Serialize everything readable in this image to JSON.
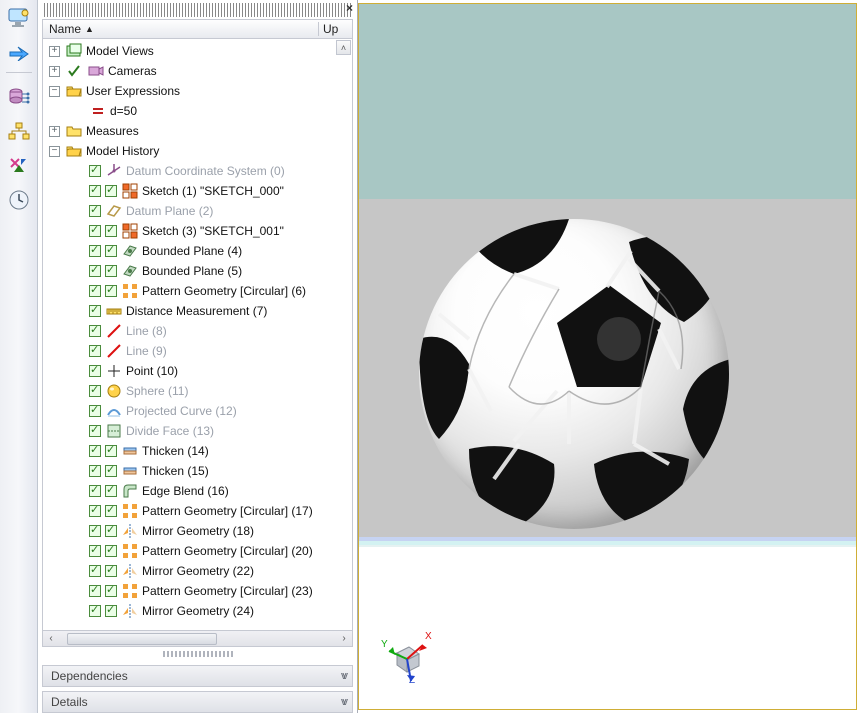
{
  "columns": {
    "name_label": "Name",
    "up_label": "Up"
  },
  "sections": {
    "dependencies": "Dependencies",
    "details": "Details"
  },
  "tree": {
    "model_views": "Model Views",
    "cameras": "Cameras",
    "user_expressions": "User Expressions",
    "expr_d": "d=50",
    "measures": "Measures",
    "model_history": "Model History",
    "items": [
      {
        "label": "Datum Coordinate System (0)",
        "dim": true,
        "icon": "csys",
        "dual": false
      },
      {
        "label": "Sketch (1) \"SKETCH_000\"",
        "dim": false,
        "icon": "sketch",
        "dual": true
      },
      {
        "label": "Datum Plane (2)",
        "dim": true,
        "icon": "plane",
        "dual": false
      },
      {
        "label": "Sketch (3) \"SKETCH_001\"",
        "dim": false,
        "icon": "sketch",
        "dual": true
      },
      {
        "label": "Bounded Plane (4)",
        "dim": false,
        "icon": "bplane",
        "dual": true
      },
      {
        "label": "Bounded Plane (5)",
        "dim": false,
        "icon": "bplane",
        "dual": true
      },
      {
        "label": "Pattern Geometry [Circular] (6)",
        "dim": false,
        "icon": "pattern",
        "dual": true
      },
      {
        "label": "Distance Measurement (7)",
        "dim": false,
        "icon": "measure",
        "dual": false
      },
      {
        "label": "Line (8)",
        "dim": true,
        "icon": "line",
        "dual": false
      },
      {
        "label": "Line (9)",
        "dim": true,
        "icon": "line",
        "dual": false
      },
      {
        "label": "Point (10)",
        "dim": false,
        "icon": "point",
        "dual": false
      },
      {
        "label": "Sphere (11)",
        "dim": true,
        "icon": "sphere",
        "dual": false
      },
      {
        "label": "Projected Curve (12)",
        "dim": true,
        "icon": "proj",
        "dual": false
      },
      {
        "label": "Divide Face (13)",
        "dim": true,
        "icon": "divide",
        "dual": false
      },
      {
        "label": "Thicken (14)",
        "dim": false,
        "icon": "thicken",
        "dual": true
      },
      {
        "label": "Thicken (15)",
        "dim": false,
        "icon": "thicken",
        "dual": true
      },
      {
        "label": "Edge Blend (16)",
        "dim": false,
        "icon": "blend",
        "dual": true
      },
      {
        "label": "Pattern Geometry [Circular] (17)",
        "dim": false,
        "icon": "pattern",
        "dual": true
      },
      {
        "label": "Mirror Geometry (18)",
        "dim": false,
        "icon": "mirror",
        "dual": true
      },
      {
        "label": "Pattern Geometry [Circular] (20)",
        "dim": false,
        "icon": "pattern",
        "dual": true
      },
      {
        "label": "Mirror Geometry (22)",
        "dim": false,
        "icon": "mirror",
        "dual": true
      },
      {
        "label": "Pattern Geometry [Circular] (23)",
        "dim": false,
        "icon": "pattern",
        "dual": true
      },
      {
        "label": "Mirror Geometry (24)",
        "dim": false,
        "icon": "mirror",
        "dual": true
      }
    ]
  },
  "triad_axes": {
    "x": "X",
    "y": "Y",
    "z": "Z"
  },
  "icons": {
    "folder_open_color": "#e8b63e",
    "check_green": "#2b7a1e"
  }
}
